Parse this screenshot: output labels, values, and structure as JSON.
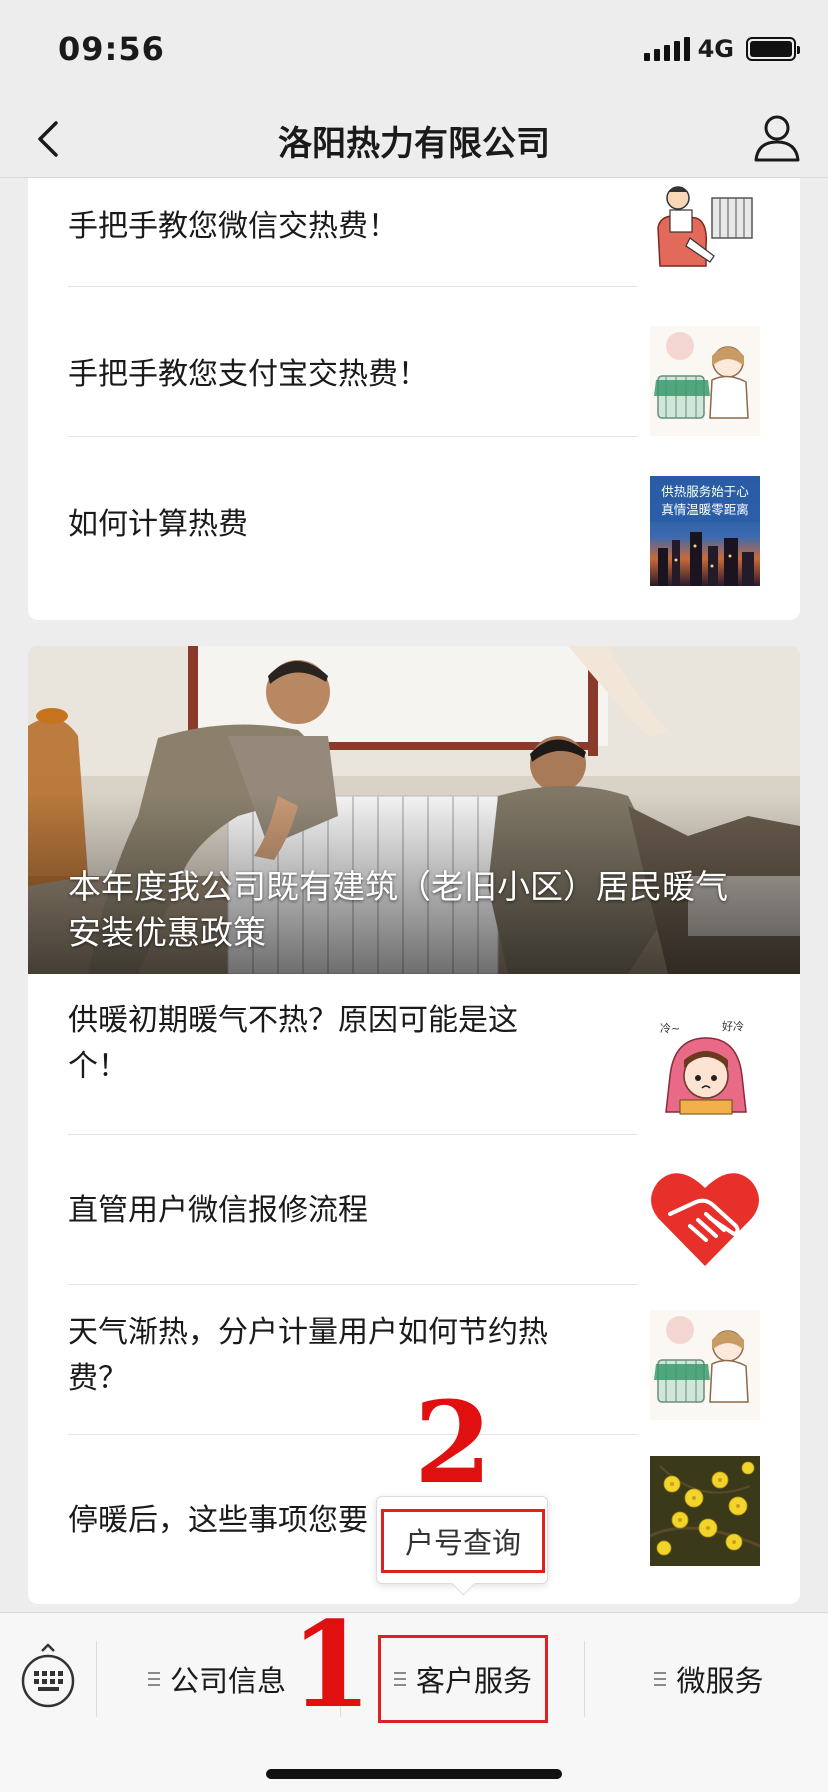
{
  "status_bar": {
    "time": "09:56",
    "network": "4G",
    "battery_level": 1.0
  },
  "nav": {
    "title": "洛阳热力有限公司",
    "back_icon": "chevron-left-icon",
    "profile_icon": "user-icon"
  },
  "articles_top": [
    {
      "title": "手把手教您微信交热费！",
      "thumb": "cartoon-man-radiator"
    },
    {
      "title": "手把手教您支付宝交热费！",
      "thumb": "cartoon-girl-radiator"
    },
    {
      "title": "如何计算热费",
      "thumb": "city-night-banner",
      "thumb_text": [
        "供热服务始于心",
        "真情温暖零距离"
      ]
    }
  ],
  "hero": {
    "title": "本年度我公司既有建筑（老旧小区）居民暖气安装优惠政策",
    "image": "workers-installing-radiator"
  },
  "articles_bottom": [
    {
      "title": "供暖初期暖气不热？原因可能是这个！",
      "thumb": "cartoon-girl-blanket",
      "thumb_labels": [
        "冷~",
        "好冷"
      ]
    },
    {
      "title": "直管用户微信报修流程",
      "thumb": "heart-handshake"
    },
    {
      "title": "天气渐热，分户计量用户如何节约热费？",
      "thumb": "cartoon-girl-radiator"
    },
    {
      "title": "停暖后，这些事项您要",
      "thumb": "yellow-flowers"
    }
  ],
  "popup": {
    "item": "户号查询"
  },
  "annotations": {
    "step1": "1",
    "step2": "2"
  },
  "menu": {
    "keyboard_icon": "keyboard-icon",
    "items": [
      {
        "label": "公司信息"
      },
      {
        "label": "客户服务"
      },
      {
        "label": "微服务"
      }
    ]
  },
  "colors": {
    "highlight_red": "#e02020",
    "background": "#ededed"
  }
}
